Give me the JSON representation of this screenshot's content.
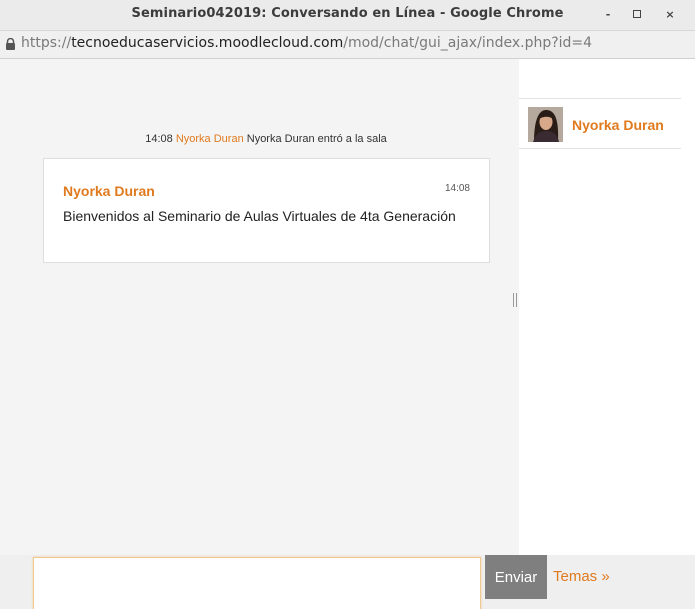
{
  "window": {
    "title": "Seminario042019: Conversando en Línea - Google Chrome",
    "min_label": "-",
    "close_label": "×"
  },
  "address": {
    "scheme": "https://",
    "host": "tecnoeducaservicios.moodlecloud.com",
    "path": "/mod/chat/gui_ajax/index.php?id=4"
  },
  "chat": {
    "system_message": {
      "time": "14:08",
      "user": "Nyorka Duran",
      "text": "Nyorka Duran entró a la sala"
    },
    "messages": [
      {
        "author": "Nyorka Duran",
        "time": "14:08",
        "text": "Bienvenidos al Seminario de Aulas Virtuales de 4ta Generación"
      }
    ]
  },
  "users": [
    {
      "name": "Nyorka Duran",
      "avatar_icon": "user-avatar-photo"
    }
  ],
  "input": {
    "value": "",
    "placeholder": "",
    "send_label": "Enviar",
    "themes_label": "Temas »"
  },
  "colors": {
    "accent": "#e07a1f",
    "send_button": "#7f7f7f"
  }
}
